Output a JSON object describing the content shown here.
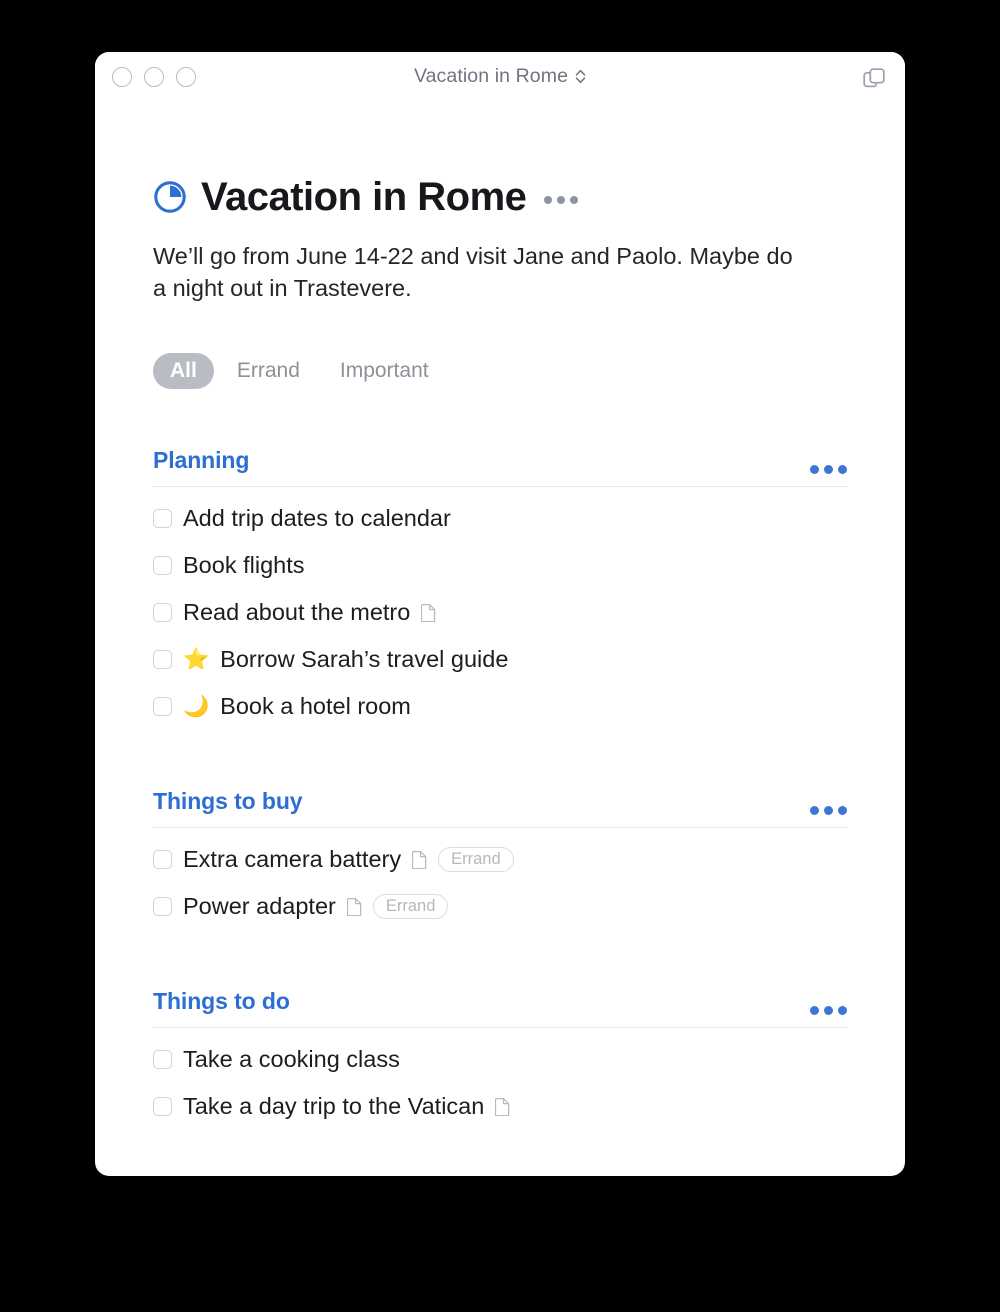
{
  "window": {
    "title": "Vacation in Rome",
    "traffic_lights": [
      "close",
      "minimize",
      "zoom"
    ],
    "right_icon": "duplicate-windows-icon"
  },
  "document": {
    "icon": "progress-pie-icon",
    "progress_percent": 25,
    "title": "Vacation in Rome",
    "description": "We’ll go from June 14-22 and visit Jane and Paolo. Maybe do a night out in Trastevere.",
    "menu": "•••"
  },
  "filters": [
    {
      "label": "All",
      "active": true
    },
    {
      "label": "Errand",
      "active": false
    },
    {
      "label": "Important",
      "active": false
    }
  ],
  "sections": [
    {
      "title": "Planning",
      "menu": "•••",
      "tasks": [
        {
          "emoji": "",
          "text": "Add trip dates to calendar",
          "has_note": false,
          "tag": ""
        },
        {
          "emoji": "",
          "text": "Book flights",
          "has_note": false,
          "tag": ""
        },
        {
          "emoji": "",
          "text": "Read about the metro",
          "has_note": true,
          "tag": ""
        },
        {
          "emoji": "⭐",
          "text": "Borrow Sarah’s travel guide",
          "has_note": false,
          "tag": ""
        },
        {
          "emoji": "🌙",
          "text": "Book a hotel room",
          "has_note": false,
          "tag": ""
        }
      ]
    },
    {
      "title": "Things to buy",
      "menu": "•••",
      "tasks": [
        {
          "emoji": "",
          "text": "Extra camera battery",
          "has_note": true,
          "tag": "Errand"
        },
        {
          "emoji": "",
          "text": "Power adapter",
          "has_note": true,
          "tag": "Errand"
        }
      ]
    },
    {
      "title": "Things to do",
      "menu": "•••",
      "tasks": [
        {
          "emoji": "",
          "text": "Take a cooking class",
          "has_note": false,
          "tag": ""
        },
        {
          "emoji": "",
          "text": "Take a day trip to the Vatican",
          "has_note": true,
          "tag": ""
        }
      ]
    }
  ],
  "colors": {
    "accent_blue": "#2d6fd1",
    "text_primary": "#1b1d21",
    "muted_gray": "#8c9199",
    "pill_active_bg": "#b9bdc3",
    "divider": "#e6e6e8",
    "backdrop": "#000000"
  }
}
